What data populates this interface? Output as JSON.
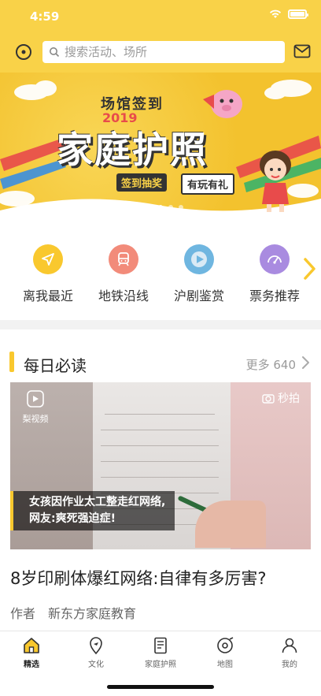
{
  "status": {
    "time": "4:59"
  },
  "search": {
    "placeholder": "搜索活动、场所"
  },
  "banner": {
    "line1": "场馆签到",
    "year": "2019",
    "title": "家庭护照",
    "tag1": "签到抽奖",
    "tag2": "有玩有礼",
    "dots": 5,
    "active_dot": 2
  },
  "categories": [
    {
      "label": "离我最近",
      "icon": "navigation-arrow-icon",
      "color": "#f9c82e"
    },
    {
      "label": "地铁沿线",
      "icon": "subway-icon",
      "color": "#f28b7a"
    },
    {
      "label": "沪剧鉴赏",
      "icon": "play-icon",
      "color": "#6fb6e0"
    },
    {
      "label": "票务推荐",
      "icon": "gauge-icon",
      "color": "#a98be0"
    }
  ],
  "section": {
    "title": "每日必读",
    "more": "更多 640"
  },
  "video": {
    "logo_text": "梨视频",
    "badge": "秒拍",
    "caption_line1": "女孩因作业太工整走红网络,",
    "caption_line2": "网友:爽死强迫症!"
  },
  "article": {
    "title": "8岁印刷体爆红网络:自律有多厉害?",
    "author_label": "作者",
    "author_name": "新东方家庭教育"
  },
  "tabs": [
    {
      "label": "精选",
      "icon": "home-icon"
    },
    {
      "label": "文化",
      "icon": "map-pin-icon"
    },
    {
      "label": "家庭护照",
      "icon": "passport-icon"
    },
    {
      "label": "地图",
      "icon": "map-icon"
    },
    {
      "label": "我的",
      "icon": "user-icon"
    }
  ],
  "colors": {
    "accent": "#f9d248",
    "highlight": "#f9c82e"
  }
}
